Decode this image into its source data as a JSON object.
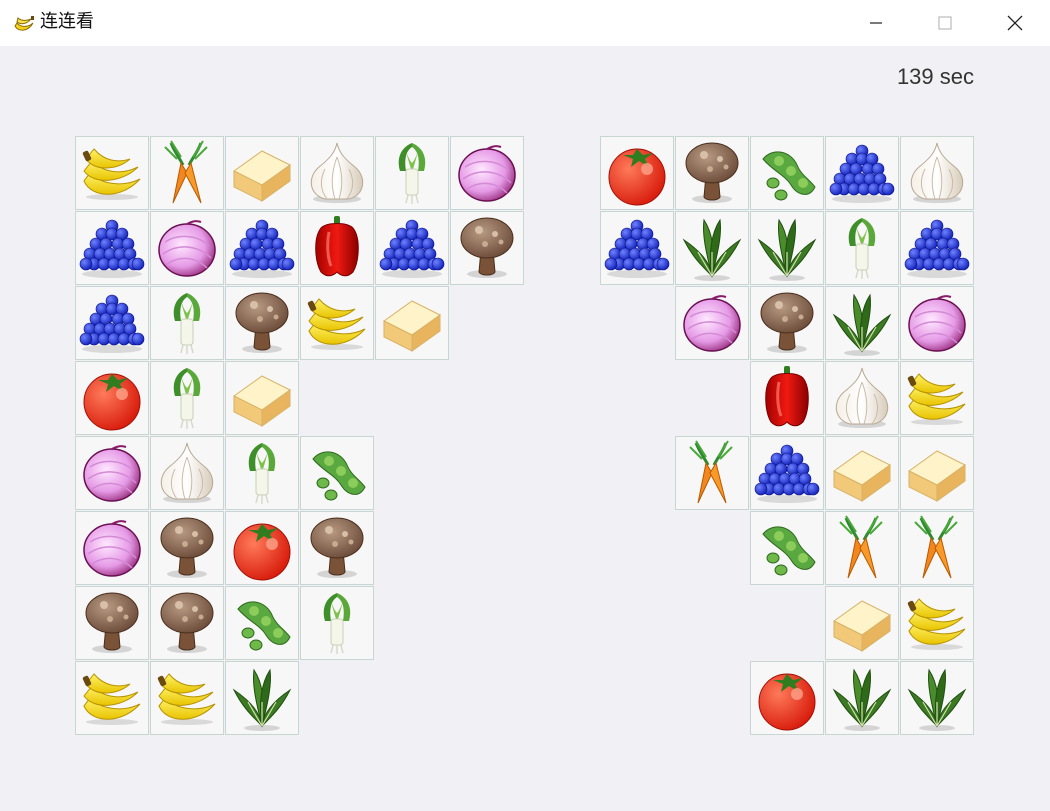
{
  "window": {
    "title": "连连看",
    "app_icon": "banana-icon",
    "controls": [
      "minimize-icon",
      "maximize-icon",
      "close-icon"
    ]
  },
  "game": {
    "timer_text": "139 sec",
    "tile_types": [
      "banana",
      "carrot",
      "tofu",
      "garlic",
      "leek",
      "onion",
      "grapes",
      "pepper",
      "mushroom",
      "tomato",
      "edamame",
      "spinach"
    ],
    "tiles": [
      {
        "col": 0,
        "row": 0,
        "type": "banana"
      },
      {
        "col": 1,
        "row": 0,
        "type": "carrot"
      },
      {
        "col": 2,
        "row": 0,
        "type": "tofu"
      },
      {
        "col": 3,
        "row": 0,
        "type": "garlic"
      },
      {
        "col": 4,
        "row": 0,
        "type": "leek"
      },
      {
        "col": 5,
        "row": 0,
        "type": "onion"
      },
      {
        "col": 7,
        "row": 0,
        "type": "tomato"
      },
      {
        "col": 8,
        "row": 0,
        "type": "mushroom"
      },
      {
        "col": 9,
        "row": 0,
        "type": "edamame"
      },
      {
        "col": 10,
        "row": 0,
        "type": "grapes"
      },
      {
        "col": 11,
        "row": 0,
        "type": "garlic"
      },
      {
        "col": 0,
        "row": 1,
        "type": "grapes"
      },
      {
        "col": 1,
        "row": 1,
        "type": "onion"
      },
      {
        "col": 2,
        "row": 1,
        "type": "grapes"
      },
      {
        "col": 3,
        "row": 1,
        "type": "pepper"
      },
      {
        "col": 4,
        "row": 1,
        "type": "grapes"
      },
      {
        "col": 5,
        "row": 1,
        "type": "mushroom"
      },
      {
        "col": 7,
        "row": 1,
        "type": "grapes"
      },
      {
        "col": 8,
        "row": 1,
        "type": "spinach"
      },
      {
        "col": 9,
        "row": 1,
        "type": "spinach"
      },
      {
        "col": 10,
        "row": 1,
        "type": "leek"
      },
      {
        "col": 11,
        "row": 1,
        "type": "grapes"
      },
      {
        "col": 0,
        "row": 2,
        "type": "grapes"
      },
      {
        "col": 1,
        "row": 2,
        "type": "leek"
      },
      {
        "col": 2,
        "row": 2,
        "type": "mushroom"
      },
      {
        "col": 3,
        "row": 2,
        "type": "banana"
      },
      {
        "col": 4,
        "row": 2,
        "type": "tofu"
      },
      {
        "col": 8,
        "row": 2,
        "type": "onion"
      },
      {
        "col": 9,
        "row": 2,
        "type": "mushroom"
      },
      {
        "col": 10,
        "row": 2,
        "type": "spinach"
      },
      {
        "col": 11,
        "row": 2,
        "type": "onion"
      },
      {
        "col": 0,
        "row": 3,
        "type": "tomato"
      },
      {
        "col": 1,
        "row": 3,
        "type": "leek"
      },
      {
        "col": 2,
        "row": 3,
        "type": "tofu"
      },
      {
        "col": 9,
        "row": 3,
        "type": "pepper"
      },
      {
        "col": 10,
        "row": 3,
        "type": "garlic"
      },
      {
        "col": 11,
        "row": 3,
        "type": "banana"
      },
      {
        "col": 0,
        "row": 4,
        "type": "onion"
      },
      {
        "col": 1,
        "row": 4,
        "type": "garlic"
      },
      {
        "col": 2,
        "row": 4,
        "type": "leek"
      },
      {
        "col": 3,
        "row": 4,
        "type": "edamame"
      },
      {
        "col": 8,
        "row": 4,
        "type": "carrot"
      },
      {
        "col": 9,
        "row": 4,
        "type": "grapes"
      },
      {
        "col": 10,
        "row": 4,
        "type": "tofu"
      },
      {
        "col": 11,
        "row": 4,
        "type": "tofu"
      },
      {
        "col": 0,
        "row": 5,
        "type": "onion"
      },
      {
        "col": 1,
        "row": 5,
        "type": "mushroom"
      },
      {
        "col": 2,
        "row": 5,
        "type": "tomato"
      },
      {
        "col": 3,
        "row": 5,
        "type": "mushroom"
      },
      {
        "col": 9,
        "row": 5,
        "type": "edamame"
      },
      {
        "col": 10,
        "row": 5,
        "type": "carrot"
      },
      {
        "col": 11,
        "row": 5,
        "type": "carrot"
      },
      {
        "col": 0,
        "row": 6,
        "type": "mushroom"
      },
      {
        "col": 1,
        "row": 6,
        "type": "mushroom"
      },
      {
        "col": 2,
        "row": 6,
        "type": "edamame"
      },
      {
        "col": 3,
        "row": 6,
        "type": "leek"
      },
      {
        "col": 10,
        "row": 6,
        "type": "tofu"
      },
      {
        "col": 11,
        "row": 6,
        "type": "banana"
      },
      {
        "col": 0,
        "row": 7,
        "type": "banana"
      },
      {
        "col": 1,
        "row": 7,
        "type": "banana"
      },
      {
        "col": 2,
        "row": 7,
        "type": "spinach"
      },
      {
        "col": 9,
        "row": 7,
        "type": "tomato"
      },
      {
        "col": 10,
        "row": 7,
        "type": "spinach"
      },
      {
        "col": 11,
        "row": 7,
        "type": "spinach"
      }
    ]
  }
}
